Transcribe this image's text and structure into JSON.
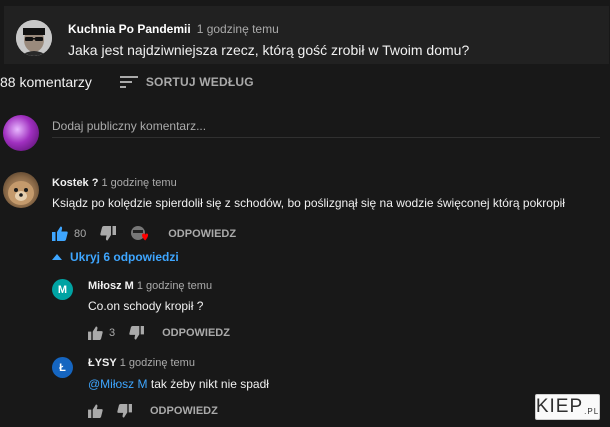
{
  "post": {
    "author": "Kuchnia Po Pandemii",
    "time": "1 godzinę temu",
    "text": "Jaka jest najdziwniejsza rzecz, którą gość zrobił w Twoim domu?"
  },
  "comments_header": {
    "count_label": "88 komentarzy",
    "sort_label": "SORTUJ WEDŁUG"
  },
  "add_comment": {
    "placeholder": "Dodaj publiczny komentarz..."
  },
  "comments": [
    {
      "author": "Kostek ?",
      "time": "1 godzinę temu",
      "text": "Ksiądz po kolędzie spierdolił się z schodów, bo poślizgnął się na wodzie święconej którą pokropił",
      "likes": "80",
      "reply_label": "ODPOWIEDZ",
      "hide_replies_label": "Ukryj 6 odpowiedzi"
    }
  ],
  "replies": [
    {
      "author": "Miłosz M",
      "avatar_letter": "M",
      "time": "1 godzinę temu",
      "text": "Co.on schody kropił ?",
      "likes": "3",
      "reply_label": "ODPOWIEDZ"
    },
    {
      "author": "ŁYSY",
      "avatar_letter": "Ł",
      "time": "1 godzinę temu",
      "mention": "@Miłosz M",
      "text": "tak żeby nikt nie spadł",
      "reply_label": "ODPOWIEDZ"
    }
  ],
  "watermark": {
    "main": "KIEP",
    "suffix": ".PL"
  },
  "colors": {
    "background": "#181818",
    "card": "#212121",
    "link_blue": "#3ea6ff",
    "muted": "#aaaaaa",
    "heart": "#ff0000"
  },
  "icons": [
    "sort-icon",
    "thumb-up-icon",
    "thumb-down-icon",
    "creator-heart-icon",
    "chevron-up-icon"
  ]
}
